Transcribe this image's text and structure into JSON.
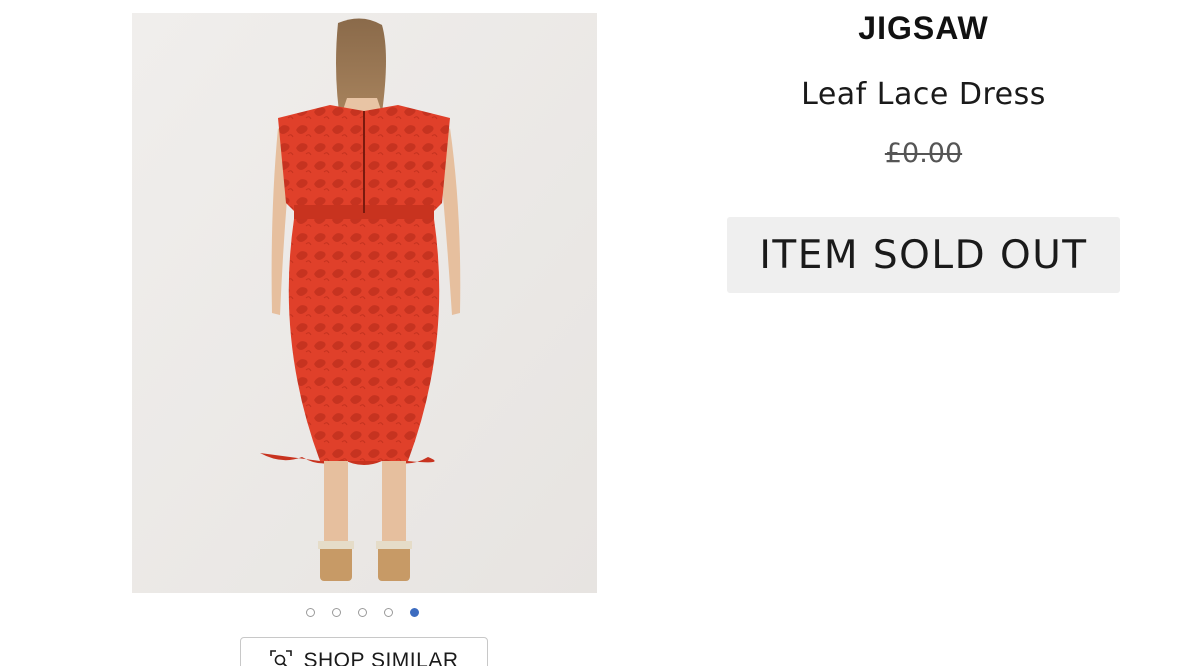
{
  "product": {
    "brand": "JIGSAW",
    "name": "Leaf Lace Dress",
    "price": "£0.00",
    "status": "ITEM SOLD OUT"
  },
  "gallery": {
    "image_alt": "Model wearing red leaf lace midi dress, back view",
    "dress_color": "#e0402a",
    "background_color": "#eeecea",
    "dots_total": 5,
    "active_dot_index": 4,
    "active_dot_color": "#3d6cc0"
  },
  "actions": {
    "shop_similar_label": "SHOP SIMILAR",
    "shop_similar_icon": "visual-search-icon"
  }
}
